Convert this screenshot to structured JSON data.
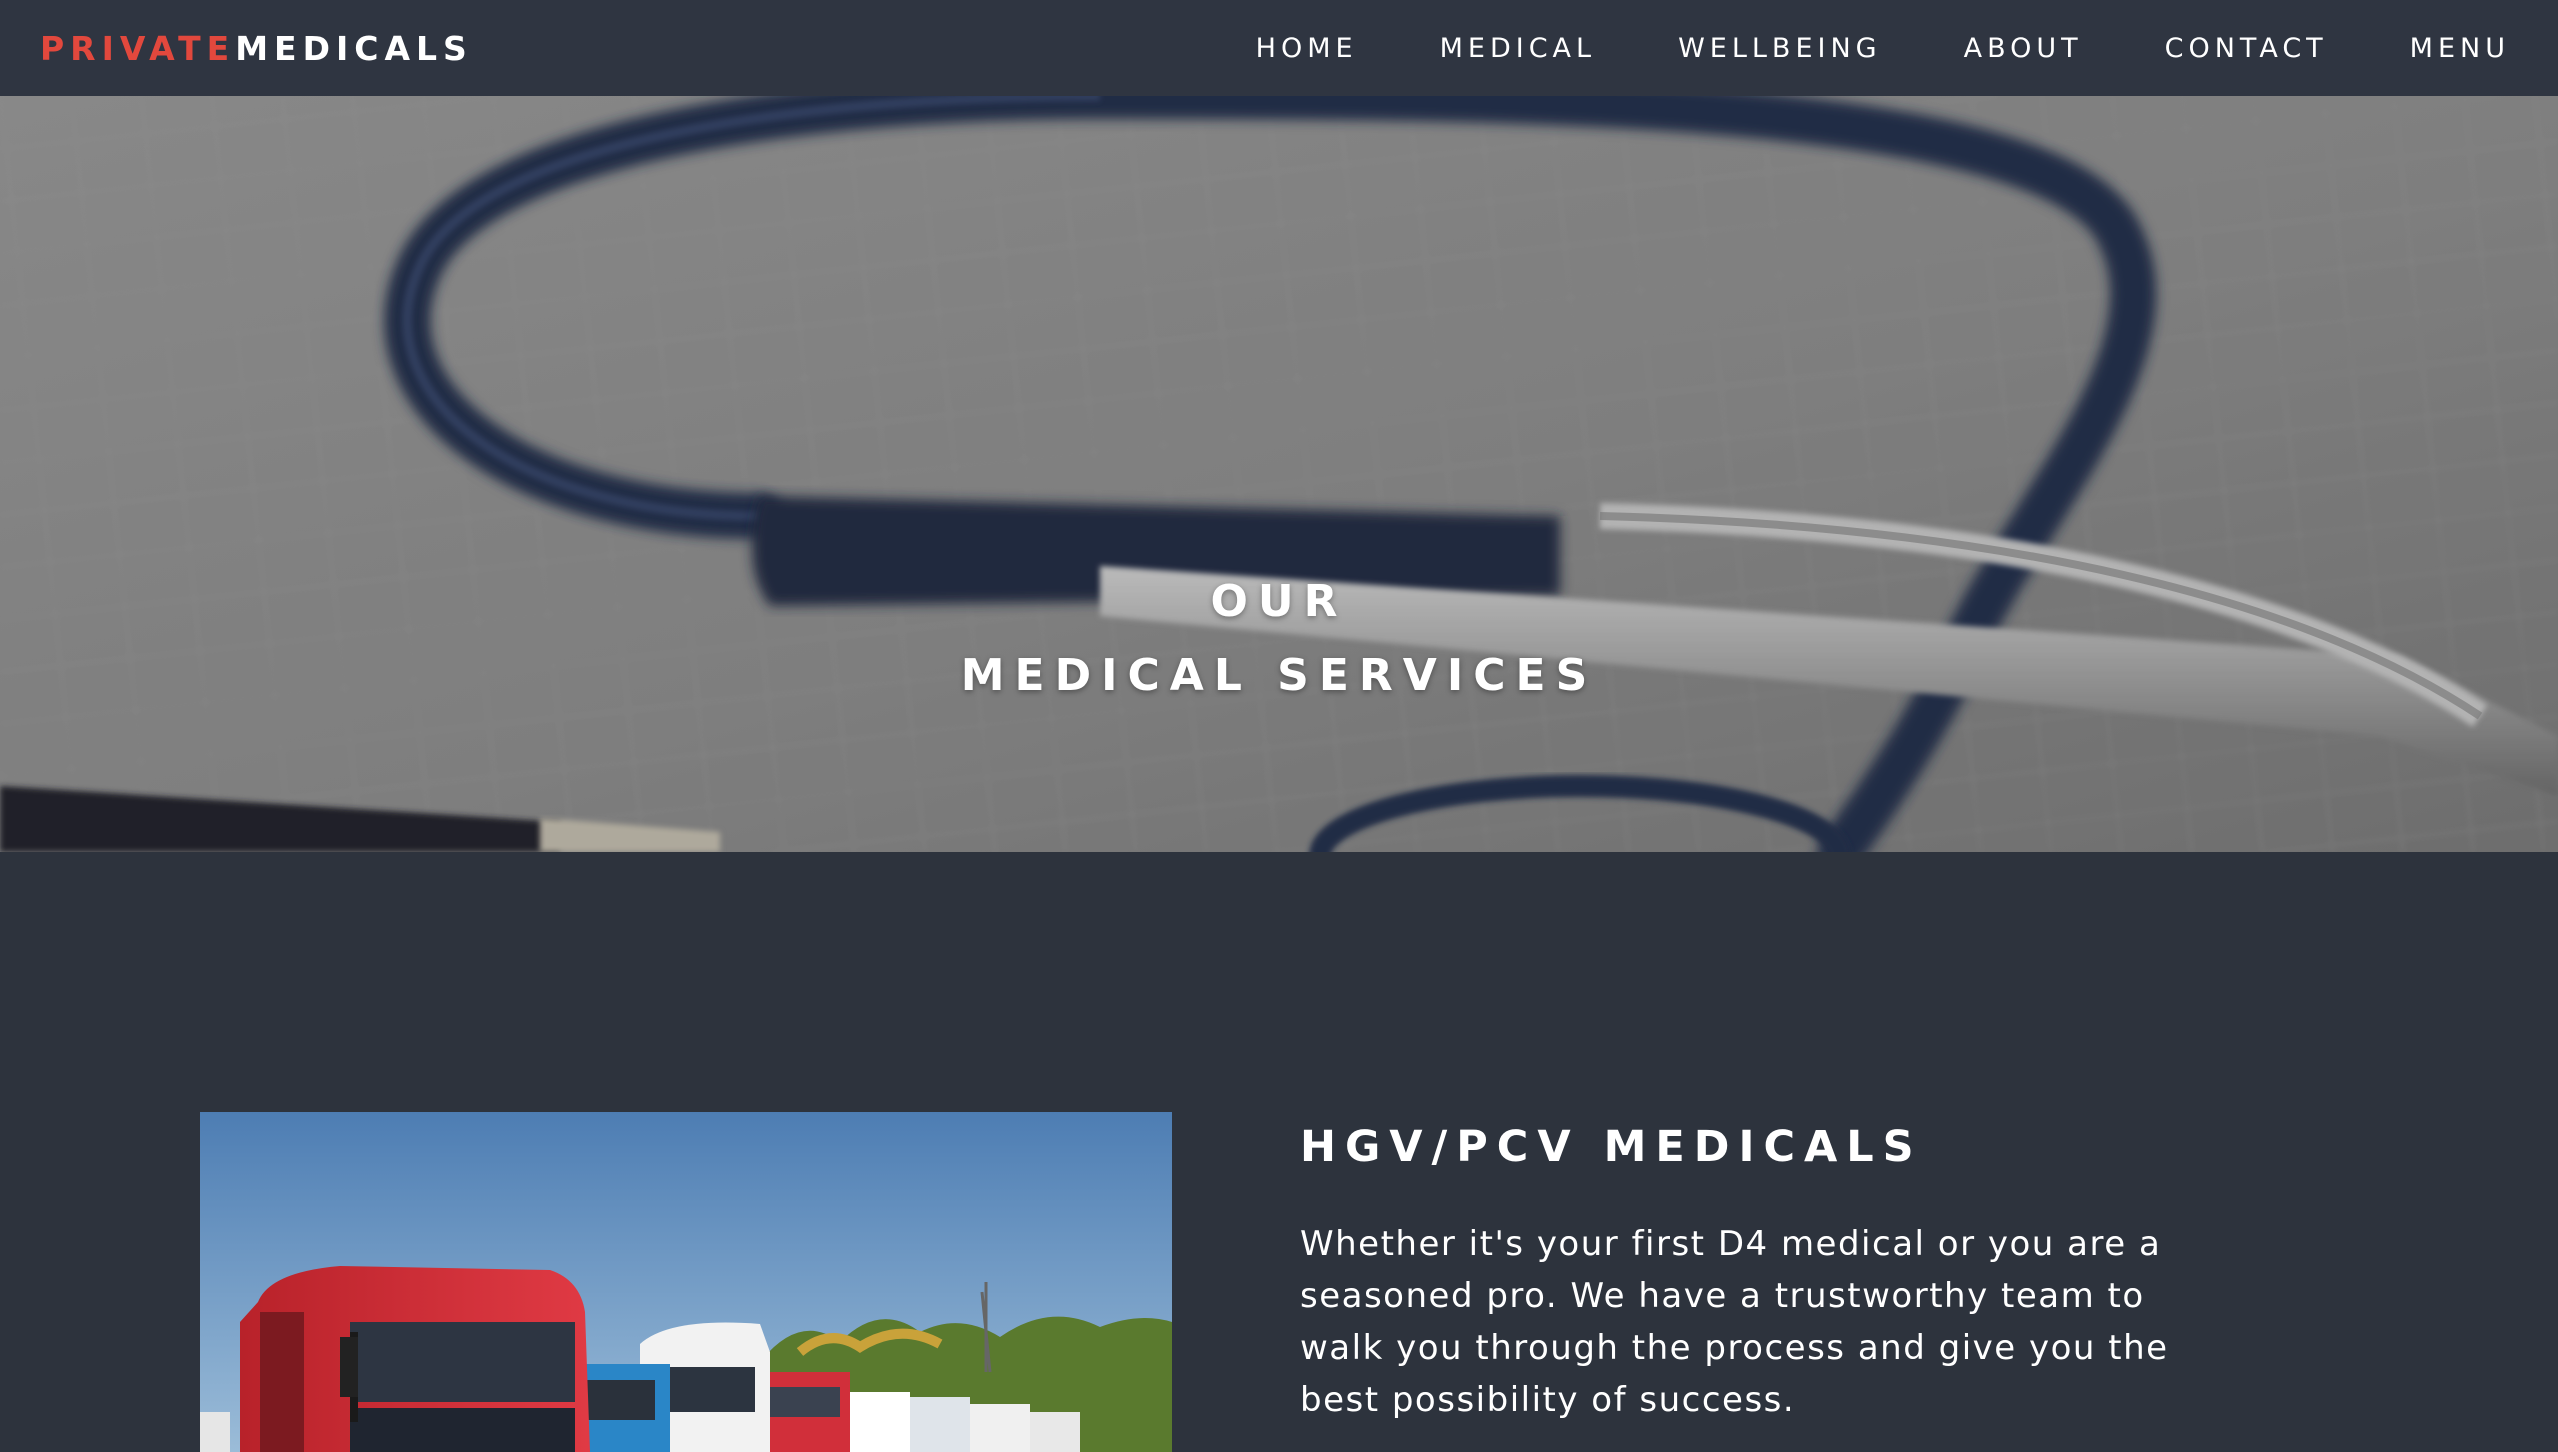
{
  "brand": {
    "part1": "PRIVATE",
    "part2": "MEDICALS"
  },
  "nav": {
    "items": [
      "HOME",
      "MEDICAL",
      "WELLBEING",
      "ABOUT",
      "CONTACT",
      "MENU"
    ]
  },
  "hero": {
    "line1": "OUR",
    "line2": "MEDICAL SERVICES"
  },
  "service": {
    "title": "HGV/PCV MEDICALS",
    "description": "Whether it's your first D4 medical or you are a seasoned pro. We have a trustworthy team to walk you through the process and give you the best possibility of success."
  },
  "colors": {
    "nav_bg": "#2f3541",
    "page_bg": "#2d333d",
    "brand_accent": "#e2483d",
    "text": "#ffffff"
  }
}
